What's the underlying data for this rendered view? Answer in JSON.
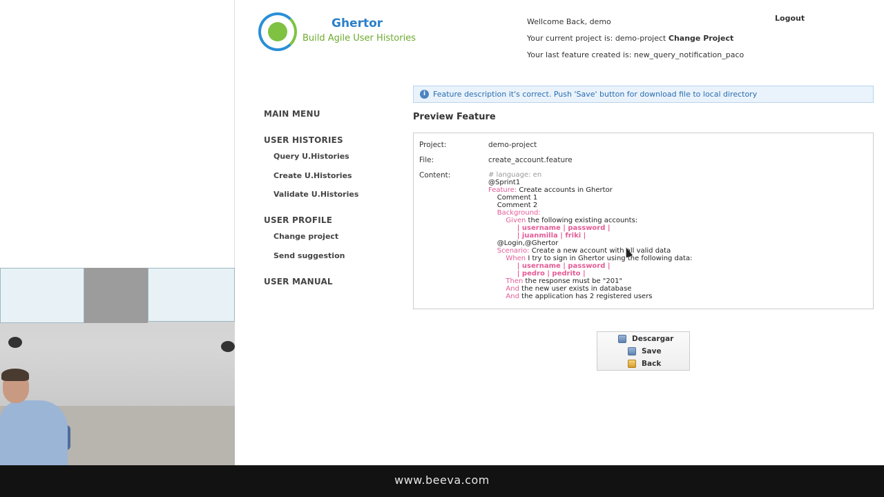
{
  "header": {
    "welcome": "Wellcome Back, demo",
    "project_prefix": "Your current project is: demo-project",
    "change_project": "Change Project",
    "last_feature": "Your last feature created is: new_query_notification_paco",
    "logout": "Logout"
  },
  "logo": {
    "title": "Ghertor",
    "subtitle": "Build Agile User Histories"
  },
  "notice": "Feature description it's correct. Push 'Save' button for download file to local directory",
  "menu": {
    "main_menu": "MAIN MENU",
    "user_histories": "USER HISTORIES",
    "items_histories": [
      "Query U.Histories",
      "Create U.Histories",
      "Validate U.Histories"
    ],
    "user_profile": "USER PROFILE",
    "items_profile": [
      "Change project",
      "Send suggestion"
    ],
    "user_manual": "USER MANUAL"
  },
  "preview": {
    "title": "Preview Feature",
    "project_label": "Project:",
    "project_value": "demo-project",
    "file_label": "File:",
    "file_value": "create_account.feature",
    "content_label": "Content:",
    "content": {
      "l1": "# language: en",
      "l2": "@Sprint1",
      "l3_kw": "Feature:",
      "l3": " Create accounts in Ghertor",
      "l4": "    Comment 1",
      "l5": "    Comment 2",
      "l6_kw": "    Background:",
      "l7_kw": "        Given",
      "l7": " the following existing accounts:",
      "l8": "            | username | password |",
      "l9": "            | juanmilla | friki |",
      "l10": "    @Login,@Ghertor",
      "l11_kw": "    Scenario:",
      "l11": " Create a new account with all valid data",
      "l12_kw": "        When",
      "l12": " I try to sign in Ghertor using the following data:",
      "l13": "            | username | password |",
      "l14": "            | pedro | pedrito |",
      "l15_kw": "        Then",
      "l15": " the response must be \"201\"",
      "l16_kw": "        And",
      "l16": " the new user exists in database",
      "l17_kw": "        And",
      "l17": " the application has 2 registered users"
    }
  },
  "actions": {
    "download": "Descargar",
    "save": "Save",
    "back": "Back"
  },
  "footer": {
    "site": "www.beeva.com"
  }
}
